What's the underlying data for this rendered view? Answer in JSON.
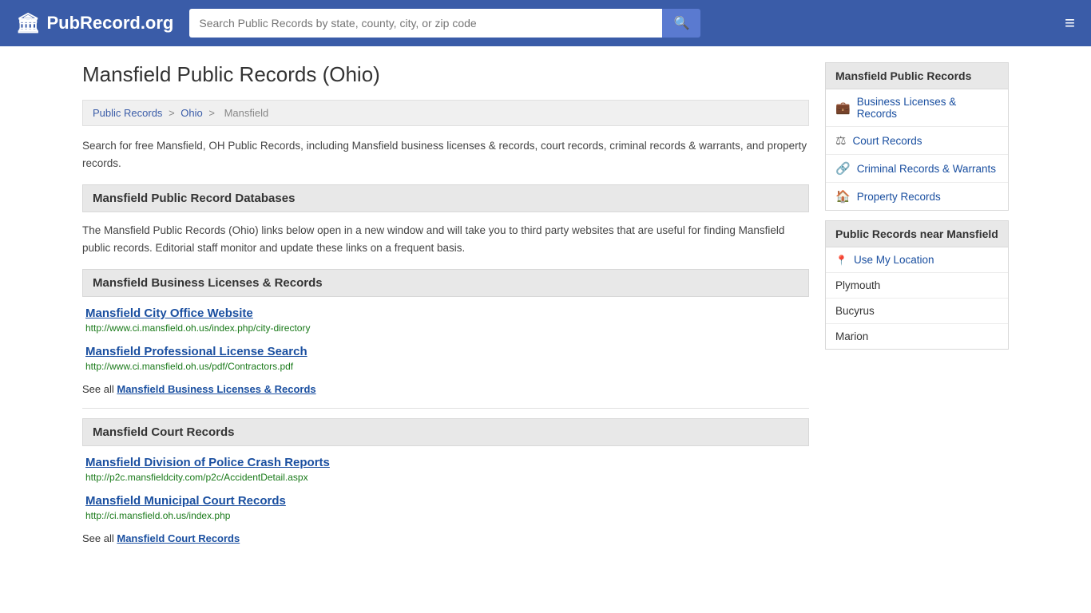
{
  "header": {
    "logo_text": "PubRecord.org",
    "logo_icon": "🏛",
    "search_placeholder": "Search Public Records by state, county, city, or zip code",
    "hamburger_icon": "≡"
  },
  "page": {
    "title": "Mansfield Public Records (Ohio)",
    "breadcrumb": {
      "items": [
        "Public Records",
        "Ohio",
        "Mansfield"
      ],
      "separators": [
        ">",
        ">"
      ]
    },
    "description": "Search for free Mansfield, OH Public Records, including Mansfield business licenses & records, court records, criminal records & warrants, and property records.",
    "sections": [
      {
        "id": "databases",
        "header": "Mansfield Public Record Databases",
        "description": "The Mansfield Public Records (Ohio) links below open in a new window and will take you to third party websites that are useful for finding Mansfield public records. Editorial staff monitor and update these links on a frequent basis."
      },
      {
        "id": "business",
        "header": "Mansfield Business Licenses & Records",
        "entries": [
          {
            "title": "Mansfield City Office Website",
            "url": "http://www.ci.mansfield.oh.us/index.php/city-directory"
          },
          {
            "title": "Mansfield Professional License Search",
            "url": "http://www.ci.mansfield.oh.us/pdf/Contractors.pdf"
          }
        ],
        "see_all_text": "See all",
        "see_all_link_text": "Mansfield Business Licenses & Records"
      },
      {
        "id": "court",
        "header": "Mansfield Court Records",
        "entries": [
          {
            "title": "Mansfield Division of Police Crash Reports",
            "url": "http://p2c.mansfieldcity.com/p2c/AccidentDetail.aspx"
          },
          {
            "title": "Mansfield Municipal Court Records",
            "url": "http://ci.mansfield.oh.us/index.php"
          }
        ],
        "see_all_text": "See all",
        "see_all_link_text": "Mansfield Court Records"
      }
    ]
  },
  "sidebar": {
    "mansfield_records": {
      "title": "Mansfield Public Records",
      "items": [
        {
          "label": "Business Licenses & Records",
          "icon": "💼"
        },
        {
          "label": "Court Records",
          "icon": "⚖"
        },
        {
          "label": "Criminal Records & Warrants",
          "icon": "🔗"
        },
        {
          "label": "Property Records",
          "icon": "🏠"
        }
      ]
    },
    "nearby": {
      "title": "Public Records near Mansfield",
      "use_location": "Use My Location",
      "cities": [
        "Plymouth",
        "Bucyrus",
        "Marion"
      ]
    }
  }
}
